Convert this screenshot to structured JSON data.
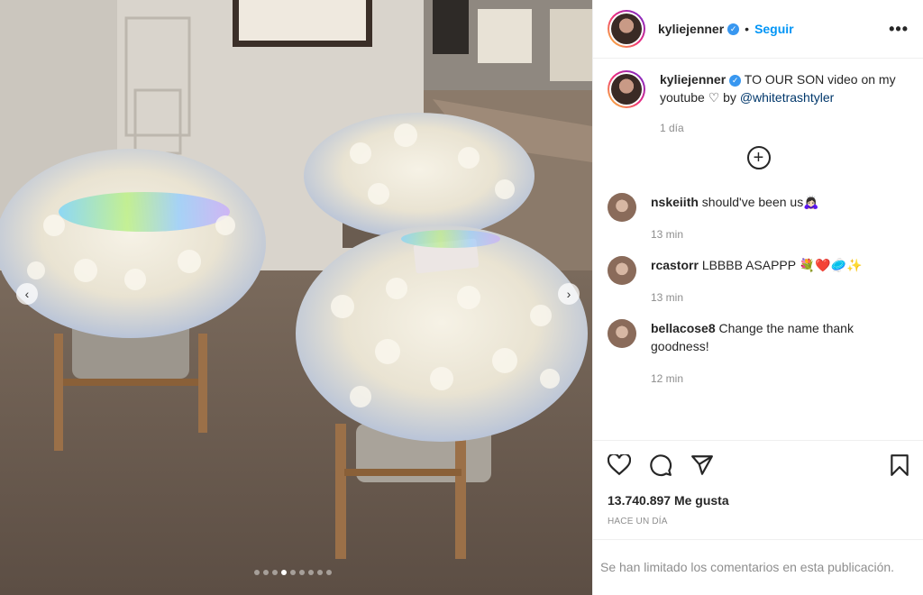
{
  "post": {
    "author": "kyliejenner",
    "verified_label": "✓",
    "separator": "•",
    "follow_label": "Seguir",
    "more_label": "•••"
  },
  "caption": {
    "username": "kyliejenner",
    "text_before_link": "TO OUR SON video on my youtube ♡ by ",
    "link": "@whitetrashtyler",
    "time": "1 día"
  },
  "load_more_icon": "plus-circle-icon",
  "comments": [
    {
      "username": "nskeiith",
      "text": "should've been us🙇🏻‍♀️",
      "time": "13 min"
    },
    {
      "username": "rcastorr",
      "text": "LBBBB ASAPPP 💐❤️🥏✨",
      "time": "13 min"
    },
    {
      "username": "bellacose8",
      "text": "Change the name thank goodness!",
      "time": "12 min"
    }
  ],
  "actions": {
    "icons": [
      "heart-icon",
      "comment-icon",
      "share-icon",
      "bookmark-icon"
    ]
  },
  "likes_text": "13.740.897 Me gusta",
  "posted_text": "HACE UN DÍA",
  "limited_text": "Se han limitado los comentarios en esta publicación.",
  "carousel": {
    "total_slides": 9,
    "active_slide": 4,
    "prev_label": "‹",
    "next_label": "›"
  },
  "colors": {
    "accent": "#0095f6",
    "verified": "#3897f0",
    "muted": "#8e8e8e"
  }
}
